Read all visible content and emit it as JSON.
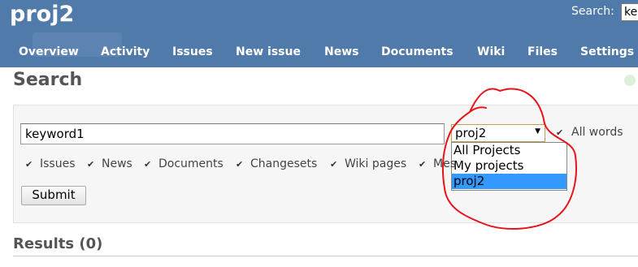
{
  "header": {
    "project_title": "proj2",
    "search_label": "Search:",
    "search_value": "ke"
  },
  "menu": {
    "items": [
      {
        "label": "Overview"
      },
      {
        "label": "Activity"
      },
      {
        "label": "Issues"
      },
      {
        "label": "New issue"
      },
      {
        "label": "News"
      },
      {
        "label": "Documents"
      },
      {
        "label": "Wiki"
      },
      {
        "label": "Files"
      },
      {
        "label": "Settings"
      }
    ]
  },
  "page": {
    "heading": "Search",
    "results_heading": "Results (0)"
  },
  "search_form": {
    "query": "keyword1",
    "scope": {
      "selected": "proj2",
      "options": [
        {
          "label": "All Projects"
        },
        {
          "label": "My projects"
        },
        {
          "label": "proj2"
        }
      ]
    },
    "all_words_label": "All words",
    "types": [
      {
        "label": "Issues"
      },
      {
        "label": "News"
      },
      {
        "label": "Documents"
      },
      {
        "label": "Changesets"
      },
      {
        "label": "Wiki pages"
      },
      {
        "label": "Mes"
      }
    ],
    "submit_label": "Submit"
  },
  "annotation": {
    "color": "#e8141a"
  }
}
